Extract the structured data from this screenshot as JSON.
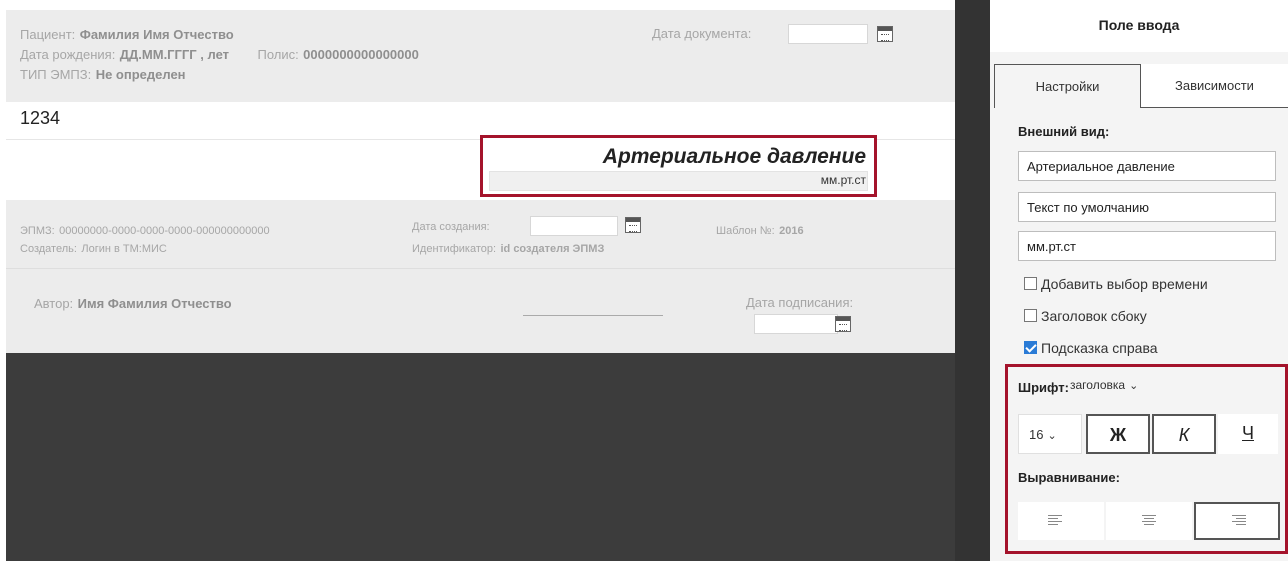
{
  "document": {
    "patient_label": "Пациент:",
    "patient_value": "Фамилия Имя Отчество",
    "birth_label": "Дата рождения:",
    "birth_value": "ДД.ММ.ГГГГ , лет",
    "policy_label": "Полис:",
    "policy_value": "0000000000000000",
    "emz_type_label": "ТИП ЭМПЗ:",
    "emz_type_value": "Не определен",
    "doc_date_label": "Дата документа:",
    "field_value": "1234",
    "field_title": "Артериальное давление",
    "field_unit": "мм.рт.ст",
    "emz_label": "ЭПМЗ:",
    "emz_value": "00000000-0000-0000-0000-000000000000",
    "creator_label": "Создатель:",
    "creator_value": "Логин в ТМ:МИС",
    "created_date_label": "Дата создания:",
    "identifier_label": "Идентификатор:",
    "identifier_value": "id создателя ЭПМЗ",
    "template_label": "Шаблон №:",
    "template_value": "2016",
    "author_label": "Автор:",
    "author_value": "Имя Фамилия Отчество",
    "sign_date_label": "Дата подписания:"
  },
  "panel": {
    "title": "Поле ввода",
    "tabs": [
      "Настройки",
      "Зависимости"
    ],
    "active_tab": "Настройки",
    "appearance_label": "Внешний вид:",
    "inputs": {
      "title_value": "Артериальное давление",
      "default_text_value": "Текст по умолчанию",
      "unit_value": "мм.рт.ст"
    },
    "checkboxes": [
      {
        "label": "Добавить выбор времени",
        "checked": false
      },
      {
        "label": "Заголовок сбоку",
        "checked": false
      },
      {
        "label": "Подсказка справа",
        "checked": true
      }
    ],
    "font_label": "Шрифт:",
    "font_value": "заголовка",
    "size_value": "16",
    "bold_label": "Ж",
    "italic_label": "К",
    "underline_label": "Ч",
    "align_label": "Выравнивание:",
    "active_alignment": "right"
  },
  "colors": {
    "highlight": "#a4132b",
    "checkbox_on": "#2a7bd6",
    "dark_area": "#3c3c3c"
  }
}
